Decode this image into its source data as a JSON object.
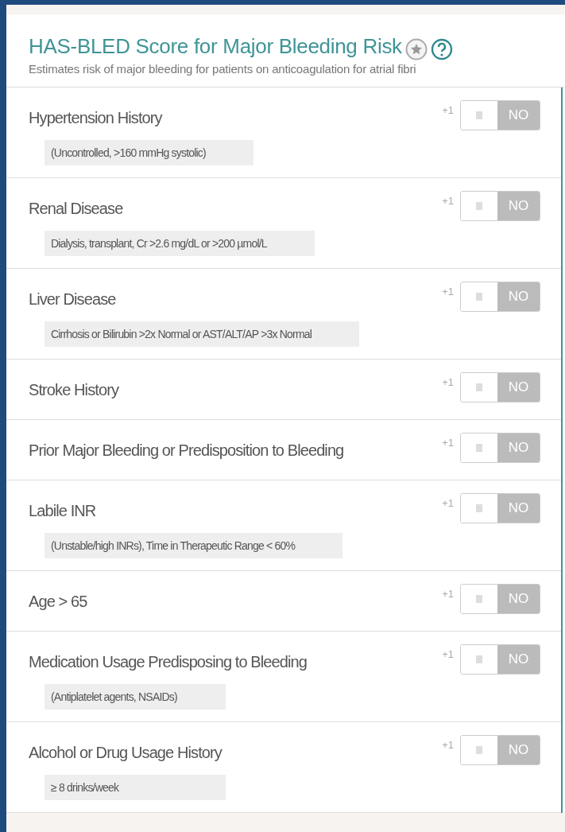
{
  "title": "HAS-BLED Score for Major Bleeding Risk",
  "subtitle": "Estimates risk of major bleeding for patients on anticoagulation for atrial fibri",
  "criteria": [
    {
      "label": "Hypertension History",
      "note": "(Uncontrolled, >160 mmHg systolic)",
      "points": "+1",
      "toggle": "NO",
      "on": false
    },
    {
      "label": "Renal Disease",
      "note": "Dialysis, transplant, Cr >2.6 mg/dL or >200 µmol/L",
      "points": "+1",
      "toggle": "NO",
      "on": false
    },
    {
      "label": "Liver Disease",
      "note": "Cirrhosis or Bilirubin >2x Normal or AST/ALT/AP >3x Normal",
      "points": "+1",
      "toggle": "NO",
      "on": false
    },
    {
      "label": "Stroke History",
      "points": "+1",
      "toggle": "NO",
      "on": false
    },
    {
      "label": "Prior Major Bleeding or Predisposition to Bleeding",
      "points": "+1",
      "toggle": "NO",
      "on": false
    },
    {
      "label": "Labile INR",
      "note": "(Unstable/high INRs), Time in Therapeutic Range < 60%",
      "points": "+1",
      "toggle": "NO",
      "on": false
    },
    {
      "label": "Age > 65",
      "points": "+1",
      "toggle": "NO",
      "on": false
    },
    {
      "label": "Medication Usage Predisposing to Bleeding",
      "note": "(Antiplatelet agents, NSAIDs)",
      "points": "+1",
      "toggle": "NO",
      "on": false
    },
    {
      "label": "Alcohol or Drug Usage History",
      "note": "≥ 8 drinks/week",
      "points": "+1",
      "toggle": "NO",
      "on": false
    }
  ]
}
